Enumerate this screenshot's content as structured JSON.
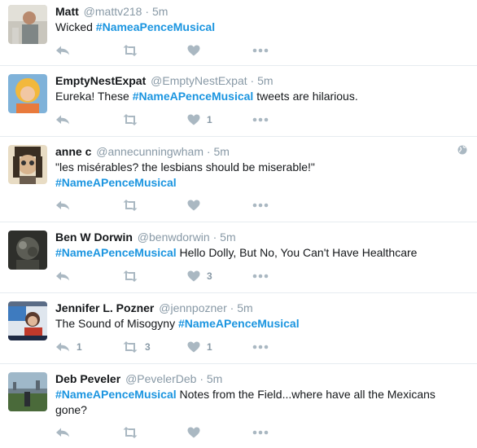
{
  "tweets": [
    {
      "name": "Matt",
      "handle": "@mattv218",
      "time": "5m",
      "text_before": "Wicked ",
      "hashtag": "#NameaPenceMusical",
      "text_after": "",
      "reply_count": "",
      "retweet_count": "",
      "like_count": ""
    },
    {
      "name": "EmptyNestExpat",
      "handle": "@EmptyNestExpat",
      "time": "5m",
      "text_before": "Eureka! These ",
      "hashtag": "#NameAPenceMusical",
      "text_after": " tweets are hilarious.",
      "reply_count": "",
      "retweet_count": "",
      "like_count": "1"
    },
    {
      "name": "anne c",
      "handle": "@annecunningwham",
      "time": "5m",
      "line1": "\"les misérables? the lesbians should be miserable!\"",
      "hashtag": "#NameAPenceMusical",
      "reply_count": "",
      "retweet_count": "",
      "like_count": ""
    },
    {
      "name": "Ben W Dorwin",
      "handle": "@benwdorwin",
      "time": "5m",
      "hashtag": "#NameAPenceMusical",
      "text_after": " Hello Dolly, But No, You Can't Have Healthcare",
      "reply_count": "",
      "retweet_count": "",
      "like_count": "3"
    },
    {
      "name": "Jennifer L. Pozner",
      "handle": "@jennpozner",
      "time": "5m",
      "text_before": "The Sound of Misogyny ",
      "hashtag": "#NameAPenceMusical",
      "reply_count": "1",
      "retweet_count": "3",
      "like_count": "1"
    },
    {
      "name": "Deb Peveler",
      "handle": "@PevelerDeb",
      "time": "5m",
      "hashtag": "#NameAPenceMusical",
      "text_after": " Notes from the Field...where have all the Mexicans",
      "line2": "gone?",
      "reply_count": "",
      "retweet_count": "",
      "like_count": ""
    }
  ],
  "separator": "·",
  "icons": {
    "reply": "reply-icon",
    "retweet": "retweet-icon",
    "like": "heart-icon",
    "more": "more-icon",
    "globe": "globe-icon"
  },
  "colors": {
    "name": "#14171a",
    "meta": "#8899a6",
    "hashtag": "#1b95e0",
    "icon": "#aab8c2",
    "divider": "#e6ecf0"
  }
}
